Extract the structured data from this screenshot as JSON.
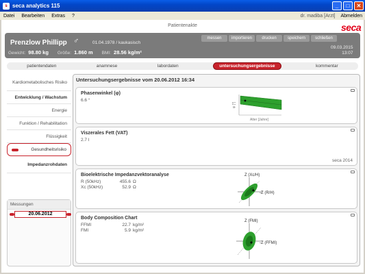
{
  "window": {
    "title": "seca analytics 115",
    "icon": "seca-app-icon"
  },
  "menu": {
    "items": [
      "Datei",
      "Bearbeiten",
      "Extras",
      "?"
    ],
    "user": "dr. madiba [Arzt]",
    "logout": "Abmelden"
  },
  "patient": {
    "header_label": "Patientenakte",
    "name": "Prenzlow Phillipp",
    "gender_symbol": "♂",
    "dob_ethnicity": "01.04.1978  /  kaukasisch",
    "weight_label": "Gewicht:",
    "weight_value": "98.80 kg",
    "height_label": "Größe:",
    "height_value": "1.860 m",
    "bmi_label": "BMI:",
    "bmi_value": "28.56 kg/m²",
    "date": "09.03.2015",
    "time": "13:07",
    "toolbar": [
      "messen",
      "importieren",
      "drucken",
      "speichern",
      "schließen"
    ],
    "logo": "seca"
  },
  "tabs": [
    {
      "label": "patientendaten",
      "active": false
    },
    {
      "label": "anamnese",
      "active": false
    },
    {
      "label": "labordaten",
      "active": false
    },
    {
      "label": "untersuchungsergebnisse",
      "active": true
    },
    {
      "label": "kommentar",
      "active": false
    }
  ],
  "leftnav": {
    "items": [
      {
        "label": "Kardiometabolisches Risiko"
      },
      {
        "label": "Entwicklung / Wachstum"
      },
      {
        "label": "Energie"
      },
      {
        "label": "Funktion / Rehabilitation"
      },
      {
        "label": "Flüssigkeit"
      },
      {
        "label": "Gesundheitsrisiko"
      },
      {
        "label": "Impedanzrohdaten"
      }
    ]
  },
  "measurements": {
    "label": "Messungen",
    "selected_date": "20.06.2012"
  },
  "main": {
    "title": "Untersuchungsergebnisse vom 20.06.2012 16:34",
    "phase": {
      "title": "Phasenwinkel (φ)",
      "value": "6.6 °",
      "xlabel": "Alter [Jahre]",
      "ylabel": "φ [°]"
    },
    "vat": {
      "title": "Viszerales Fett (VAT)",
      "value": "2.7 l",
      "note": "seca 2014"
    },
    "bia": {
      "title": "Bioelektrische Impedanzvektoranalyse",
      "r_label": "R (50kHz)",
      "r_value": "455.6",
      "r_unit": "Ω",
      "xc_label": "Xc (50kHz)",
      "xc_value": "52.9",
      "xc_unit": "Ω",
      "axis_y": "Z (Xc/H)",
      "axis_x": "-Z (R/H)"
    },
    "bcc": {
      "title": "Body Composition Chart",
      "ffmi_label": "FFMI",
      "ffmi_value": "22.7",
      "ffmi_unit": "kg/m²",
      "fmi_label": "FMI",
      "fmi_value": "5.9",
      "fmi_unit": "kg/m²",
      "axis_y": "Z (FMI)",
      "axis_x": "-Z (FFMI)"
    }
  },
  "colors": {
    "accent": "#c8232c",
    "band": "#2ea02e",
    "titlebar": "#0a4fd8"
  }
}
